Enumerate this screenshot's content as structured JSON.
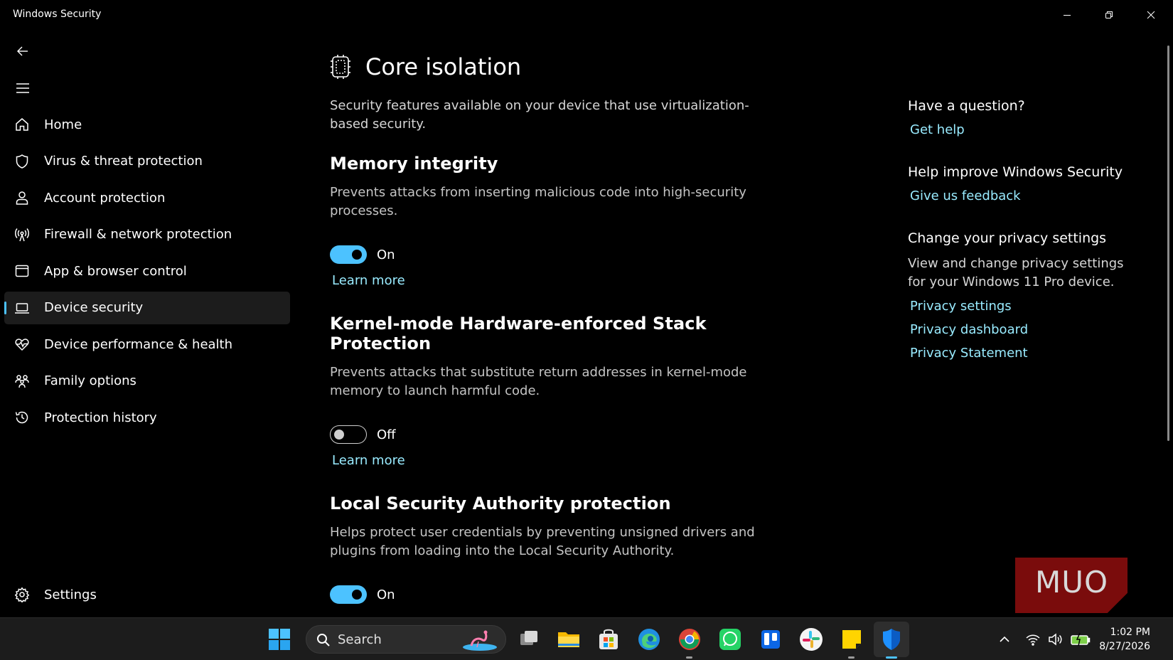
{
  "window": {
    "title": "Windows Security"
  },
  "sidebar": {
    "items": [
      {
        "label": "Home",
        "icon": "home-icon"
      },
      {
        "label": "Virus & threat protection",
        "icon": "shield-icon"
      },
      {
        "label": "Account protection",
        "icon": "person-icon"
      },
      {
        "label": "Firewall & network protection",
        "icon": "antenna-icon"
      },
      {
        "label": "App & browser control",
        "icon": "browser-window-icon"
      },
      {
        "label": "Device security",
        "icon": "laptop-icon",
        "selected": true
      },
      {
        "label": "Device performance & health",
        "icon": "heart-pulse-icon"
      },
      {
        "label": "Family options",
        "icon": "family-icon"
      },
      {
        "label": "Protection history",
        "icon": "history-icon"
      }
    ],
    "settings_label": "Settings"
  },
  "main": {
    "title": "Core isolation",
    "intro": "Security features available on your device that use virtualization-based security.",
    "features": [
      {
        "title": "Memory integrity",
        "description": "Prevents attacks from inserting malicious code into high-security processes.",
        "toggle_state": "On",
        "learn_more": "Learn more"
      },
      {
        "title": "Kernel-mode Hardware-enforced Stack Protection",
        "description": "Prevents attacks that substitute return addresses in kernel-mode memory to launch harmful code.",
        "toggle_state": "Off",
        "learn_more": "Learn more"
      },
      {
        "title": "Local Security Authority protection",
        "description": "Helps protect user credentials by preventing unsigned drivers and plugins from loading into the Local Security Authority.",
        "toggle_state": "On"
      }
    ]
  },
  "side_panel": {
    "question_heading": "Have a question?",
    "get_help": "Get help",
    "improve_heading": "Help improve Windows Security",
    "feedback": "Give us feedback",
    "privacy_heading": "Change your privacy settings",
    "privacy_text": "View and change privacy settings for your Windows 11 Pro device.",
    "privacy_settings": "Privacy settings",
    "privacy_dashboard": "Privacy dashboard",
    "privacy_statement": "Privacy Statement"
  },
  "watermark": {
    "text": "MUO"
  },
  "taskbar": {
    "search_placeholder": "Search",
    "time": "1:02 PM",
    "date": "8/27/2026"
  },
  "colors": {
    "accent": "#4cc2ff",
    "link": "#99ebff",
    "background": "#000000",
    "selected_nav": "#1c1c1c",
    "watermark_red": "#7a0c0c"
  }
}
